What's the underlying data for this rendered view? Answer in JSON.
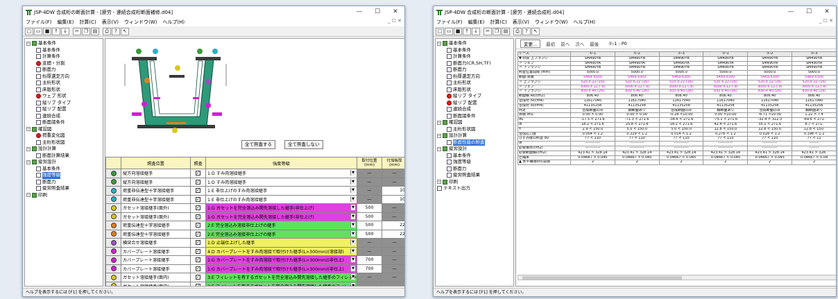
{
  "win1": {
    "title": "JSP-4DW 合成桁の断面計算 - [疲労 - 連続合成桁断面補修.d04]",
    "menu": [
      "ファイル(F)",
      "編集(E)",
      "計算(C)",
      "表示(V)",
      "ウィンドウ(W)",
      "ヘルプ(H)"
    ],
    "tree": [
      {
        "t": "基本条件",
        "lv": 0,
        "k": "pm"
      },
      {
        "t": "基本条件",
        "lv": 1,
        "k": "d"
      },
      {
        "t": "計算条件",
        "lv": 1,
        "k": "d"
      },
      {
        "t": "支間・分割",
        "lv": 1,
        "k": "r"
      },
      {
        "t": "断面力",
        "lv": 1,
        "k": "d"
      },
      {
        "t": "桁厚選定方向",
        "lv": 1,
        "k": "d"
      },
      {
        "t": "主桁形状",
        "lv": 1,
        "k": "d"
      },
      {
        "t": "床版形状",
        "lv": 1,
        "k": "d"
      },
      {
        "t": "ウェブ 形状",
        "lv": 1,
        "k": "r"
      },
      {
        "t": "縦リブ タイプ",
        "lv": 1,
        "k": "d"
      },
      {
        "t": "縦リブ 配置",
        "lv": 1,
        "k": "d"
      },
      {
        "t": "連続合成",
        "lv": 1,
        "k": "d"
      },
      {
        "t": "断面諸条件",
        "lv": 1,
        "k": "d"
      },
      {
        "t": "確認図",
        "lv": 0,
        "k": "pm"
      },
      {
        "t": "荷重変化図",
        "lv": 1,
        "k": "r"
      },
      {
        "t": "主桁形状図",
        "lv": 1,
        "k": "d"
      },
      {
        "t": "設計計算",
        "lv": 0,
        "k": "pm"
      },
      {
        "t": "断面計算結果",
        "lv": 1,
        "k": "d"
      },
      {
        "t": "疲労設計",
        "lv": 0,
        "k": "pm"
      },
      {
        "t": "基本条件",
        "lv": 1,
        "k": "d"
      },
      {
        "t": "強度等級",
        "lv": 1,
        "k": "d",
        "sel": true
      },
      {
        "t": "断面力",
        "lv": 1,
        "k": "d"
      },
      {
        "t": "疲労照査結果",
        "lv": 1,
        "k": "d"
      },
      {
        "t": "印刷",
        "lv": 0,
        "k": "pm"
      }
    ],
    "btn_all_check": "全て照査する",
    "btn_all_uncheck": "全て照査しない",
    "headers": [
      "照査位置",
      "照査",
      "強度等級",
      "取付位置\n(mm)",
      "付加板厚\n(mm)"
    ],
    "rows": [
      {
        "c": "#3a9a3a",
        "p": "縦方向溶接継手",
        "g": "1:D すみ肉溶接継手",
        "bg": "#ffffff",
        "a": "—",
        "b": "—"
      },
      {
        "c": "#3a9a3a",
        "p": "縦方向溶接継手",
        "g": "1:D すみ肉溶接継手",
        "bg": "#ffffff",
        "a": "—",
        "b": "—"
      },
      {
        "c": "#2ab0c8",
        "p": "荷重非伝達型十字溶接継手",
        "g": "1:E 非仕上げのすみ肉溶接継手",
        "bg": "#ffffff",
        "a": "—",
        "b": "10"
      },
      {
        "c": "#2ab0c8",
        "p": "荷重非伝達型十字溶接継手",
        "g": "1:E 非仕上げのすみ肉溶接継手",
        "bg": "#ffffff",
        "a": "—",
        "b": "10"
      },
      {
        "c": "#d8c820",
        "p": "ガセット溶接継手(面外)",
        "g": "1:G ガセットを完全溶込み開先溶接した継手(非仕上げ)",
        "bg": "#e040e0",
        "a": "500",
        "b": "—"
      },
      {
        "c": "#d8c820",
        "p": "ガセット溶接継手(面外)",
        "g": "1:G ガセットを完全溶込み開先溶接した継手(非仕上げ)",
        "bg": "#e040e0",
        "a": "500",
        "b": "—"
      },
      {
        "c": "#e08020",
        "p": "荷重伝達型十字溶接継手",
        "g": "2:E 完全溶込み溶接非仕上げの継手",
        "bg": "#60e060",
        "a": "500",
        "b": "22"
      },
      {
        "c": "#e08020",
        "p": "荷重伝達型十字溶接継手",
        "g": "2:E 完全溶込み溶接非仕上げの継手",
        "bg": "#60e060",
        "a": "500",
        "b": "22"
      },
      {
        "c": "#9a50c0",
        "p": "横突合せ溶接継手",
        "g": "1:D 止端仕上げした継手",
        "bg": "#f0f060",
        "a": "—",
        "b": "—"
      },
      {
        "c": "#d020d0",
        "p": "カバープレート溶接継手",
        "g": "4:D カバープレートをすみ肉溶接で取付けた継手(L>300mm)(溶接部)",
        "bg": "#f0f060",
        "a": "—",
        "b": "—"
      },
      {
        "c": "#d020d0",
        "p": "カバープレート溶接継手",
        "g": "1:G カバープレートをすみ肉溶接で取付けた継手(L>300mm)(非仕上)",
        "bg": "#e040e0",
        "a": "700",
        "b": "—"
      },
      {
        "c": "#d020d0",
        "p": "カバープレート溶接継手",
        "g": "1:G カバープレートをすみ肉溶接で取付けた継手(L>300mm)(非仕上)",
        "bg": "#e040e0",
        "a": "700",
        "b": "—"
      },
      {
        "c": "#d8c820",
        "p": "ガセット溶接継手(面内)",
        "g": "3:E フィレットを有するガセットを完全溶込み開先溶接した継手のフィレット",
        "bg": "#60e060",
        "a": "—",
        "b": "—"
      },
      {
        "c": "#d8c820",
        "p": "ガセット溶接継手(面内)",
        "g": "3:E フィレットを有するガセットを完全溶込み開先溶接した継手のフィレット",
        "bg": "#60e060",
        "a": "—",
        "b": "—"
      },
      {
        "c": "#d8c820",
        "p": "ガセット溶接継手(面内)",
        "g": "3:E フィレットを有するガセットを完全溶込み開先溶接した継手のフィレット",
        "bg": "#60e060",
        "a": "—",
        "b": "—"
      }
    ],
    "status": "ヘルプを表示するには [F1] を押してください。"
  },
  "win2": {
    "title": "JSP-4DW 合成桁の断面計算 - [疲労 - 連続合成桁.d04]",
    "menu": [
      "ファイル(F)",
      "編集(E)",
      "計算(C)",
      "表示(V)",
      "ウィンドウ(W)",
      "ヘルプ(H)"
    ],
    "tree": [
      {
        "t": "基本条件",
        "lv": 0,
        "k": "pm"
      },
      {
        "t": "基本条件",
        "lv": 1,
        "k": "d"
      },
      {
        "t": "計算条件",
        "lv": 1,
        "k": "d"
      },
      {
        "t": "断面力(CR,SH,TF)",
        "lv": 1,
        "k": "d"
      },
      {
        "t": "断面力",
        "lv": 1,
        "k": "d"
      },
      {
        "t": "桁厚選定方向",
        "lv": 1,
        "k": "d"
      },
      {
        "t": "主桁形状",
        "lv": 1,
        "k": "d"
      },
      {
        "t": "床版形状",
        "lv": 1,
        "k": "d"
      },
      {
        "t": "縦リブ タイプ",
        "lv": 1,
        "k": "r"
      },
      {
        "t": "縦リブ 配置",
        "lv": 1,
        "k": "r"
      },
      {
        "t": "連続合成",
        "lv": 1,
        "k": "d"
      },
      {
        "t": "断面諸条件",
        "lv": 1,
        "k": "d"
      },
      {
        "t": "確認図",
        "lv": 0,
        "k": "pm"
      },
      {
        "t": "主桁形状図",
        "lv": 1,
        "k": "d"
      },
      {
        "t": "設計計算",
        "lv": 0,
        "k": "pm"
      },
      {
        "t": "断面性能の照査",
        "lv": 1,
        "k": "d",
        "sel": true
      },
      {
        "t": "疲労設計",
        "lv": 0,
        "k": "pm"
      },
      {
        "t": "基本条件",
        "lv": 1,
        "k": "d"
      },
      {
        "t": "強度等級",
        "lv": 1,
        "k": "d"
      },
      {
        "t": "断面力",
        "lv": 1,
        "k": "d"
      },
      {
        "t": "疲労照査結果",
        "lv": 1,
        "k": "d"
      },
      {
        "t": "印刷",
        "lv": 0,
        "k": "pm"
      },
      {
        "t": "テキスト出力",
        "lv": 0,
        "k": "d"
      }
    ],
    "nav": [
      "変更...",
      "最初",
      "前へ",
      "次へ",
      "最後",
      "①-1 : P0"
    ],
    "cols": [
      "①-1",
      "①-2",
      "①-3",
      "①-1",
      "①-2",
      "①-3"
    ],
    "rows": [
      {
        "h": "ケース",
        "v": [
          "①-1",
          "①-2",
          "①-3",
          "①-1",
          "①-2",
          "①-3"
        ],
        "cls": "hd"
      },
      {
        "h": "▼ 材質 上フランジ",
        "v": [
          "SM490YB",
          "SM490YB",
          "SM490YB",
          "SM490YB",
          "SM490YB",
          "SM490YB"
        ]
      },
      {
        "h": "   〃 ウェブ",
        "v": [
          "SM490YA",
          "SM490YA",
          "SM490YA",
          "SM490YA",
          "SM490YA",
          "SM490YA"
        ]
      },
      {
        "h": "   〃 下フランジ",
        "v": [
          "SM490YB",
          "SM490YB",
          "SM490YB",
          "SM490YB",
          "SM490YB",
          "SM490YB"
        ]
      },
      {
        "h": "照査位置間隔 (mm)",
        "v": [
          "5000.0",
          "5000.0",
          "5000.0",
          "5000.0",
          "5000.0",
          "5000.0"
        ]
      },
      {
        "h": "断面 床版",
        "v": [
          "5469 x300",
          "5469 x300",
          "5469 x300",
          "5469 x300",
          "5469 x300",
          "5469 x300"
        ],
        "cls": "mag"
      },
      {
        "h": "   〃 上フランジ",
        "v": [
          "520 x 22 (16)",
          "520 x 22 (16)",
          "520 x 22 (16)",
          "520 x 22 (16)",
          "520 x 22 (16)",
          "520 x 22 (16)"
        ],
        "cls": "mag"
      },
      {
        "h": "   〃 ウェブ",
        "v": [
          "3000 x 12 ( 9)",
          "3000 x 12 ( 9)",
          "3000 x 12 ( 9)",
          "3000 x 12 ( 9)",
          "3000 x 12 ( 9)",
          "3000 x 12 ( 9)"
        ],
        "cls": "mag"
      },
      {
        "h": "   〃 下フランジ",
        "v": [
          "830 x 40 (26)",
          "830 x 40 (26)",
          "830 x 40 (26)",
          "830 x 40 (26)",
          "830 x 40 (26)",
          "830 x 40 (26)"
        ],
        "cls": "mag"
      },
      {
        "h": "断面積 As(cm2)",
        "v": [
          "806.40",
          "806.40",
          "806.40",
          "806.40",
          "806.40",
          "806.40"
        ]
      },
      {
        "h": "合成桁 Iv(cm4)",
        "v": [
          "11617040",
          "11617040",
          "11617040",
          "11617040",
          "11617040",
          "11617040"
        ]
      },
      {
        "h": "合成桁 Is(cm4)",
        "v": [
          "41135258",
          "41135258",
          "41135258",
          "41135258",
          "41135258",
          "41135258"
        ]
      },
      {
        "h": "判定",
        "v": [
          "合成断面のみ",
          "鋼断面あり",
          "合成断面のみ",
          "鋼断面あり",
          "合成断面のみ",
          "鋼断面あり"
        ]
      },
      {
        "h": "床版 σcu",
        "v": [
          "0.00 > 0.00",
          "0.00 > 0.00",
          "-0.24 <10.00",
          "0.00 >10.00",
          "-6.71 <10.00",
          "1.22 > 7.4"
        ]
      },
      {
        "h": "σu",
        "v": [
          "-17.5 < 271.6",
          "-71.3 < 271.6",
          "-38.6 < 271.6",
          "-75.1 < 271.6",
          "-32.4 < 312.3",
          "-69.6 < 271."
        ]
      },
      {
        "h": "σl",
        "v": [
          "18.2 < 271.6",
          "25.8 < 271.6",
          "18.2 < 271.6",
          "42.4 < 271.6",
          "35.1 < 271.6",
          "8.7 < 271."
        ]
      },
      {
        "h": "τ",
        "v": [
          "2.9 < 150.0",
          "5.0 < 150.0",
          "5.0 < 150.0",
          "12.8 < 150.0",
          "12.8 < 150.0",
          "12.8 < 150."
        ]
      },
      {
        "h": "合成応力度",
        "v": [
          "0.004 < 1.2",
          "0.229 < 1.2",
          "0.014 < 1.2",
          "0.276 < 1.2",
          "0.028 < 1.2",
          "0.198 < 1.2"
        ]
      },
      {
        "h": "ひずみ度の照査 σu",
        "v": [
          "77 < 110",
          "77 < 110",
          "77 < 110",
          "77 < 110",
          "77 < 110",
          "77 < 11"
        ]
      },
      {
        "h": "σl",
        "v": [
          "------------",
          "------------",
          "------------",
          "------------",
          "------------",
          "--------"
        ]
      },
      {
        "h": "必要板厚(cm2)",
        "v": [
          "------------",
          "------------",
          "------------",
          "------------",
          "------------",
          "--------"
        ]
      },
      {
        "h": "必要断面積(cm2)",
        "v": [
          "423.41 > 328.14",
          "423.41 > 328.14",
          "423.41 > 328.14",
          "423.41 > 328.14",
          "423.41 > 328.14",
          "423.41 > 328."
        ]
      },
      {
        "h": "圧縮率",
        "v": [
          "0.04667 > 0.045",
          "0.04667 > 0.045",
          "0.04667 > 0.045",
          "0.04667 > 0.045",
          "0.04667 > 0.045",
          "0.04667 > 0.04"
        ]
      },
      {
        "h": "▲ 水平補剛材の段数",
        "v": [
          "2",
          "2",
          "2",
          "2",
          "2",
          "2"
        ]
      }
    ],
    "status": "ヘルプを表示するには [F1] を押してください。"
  }
}
